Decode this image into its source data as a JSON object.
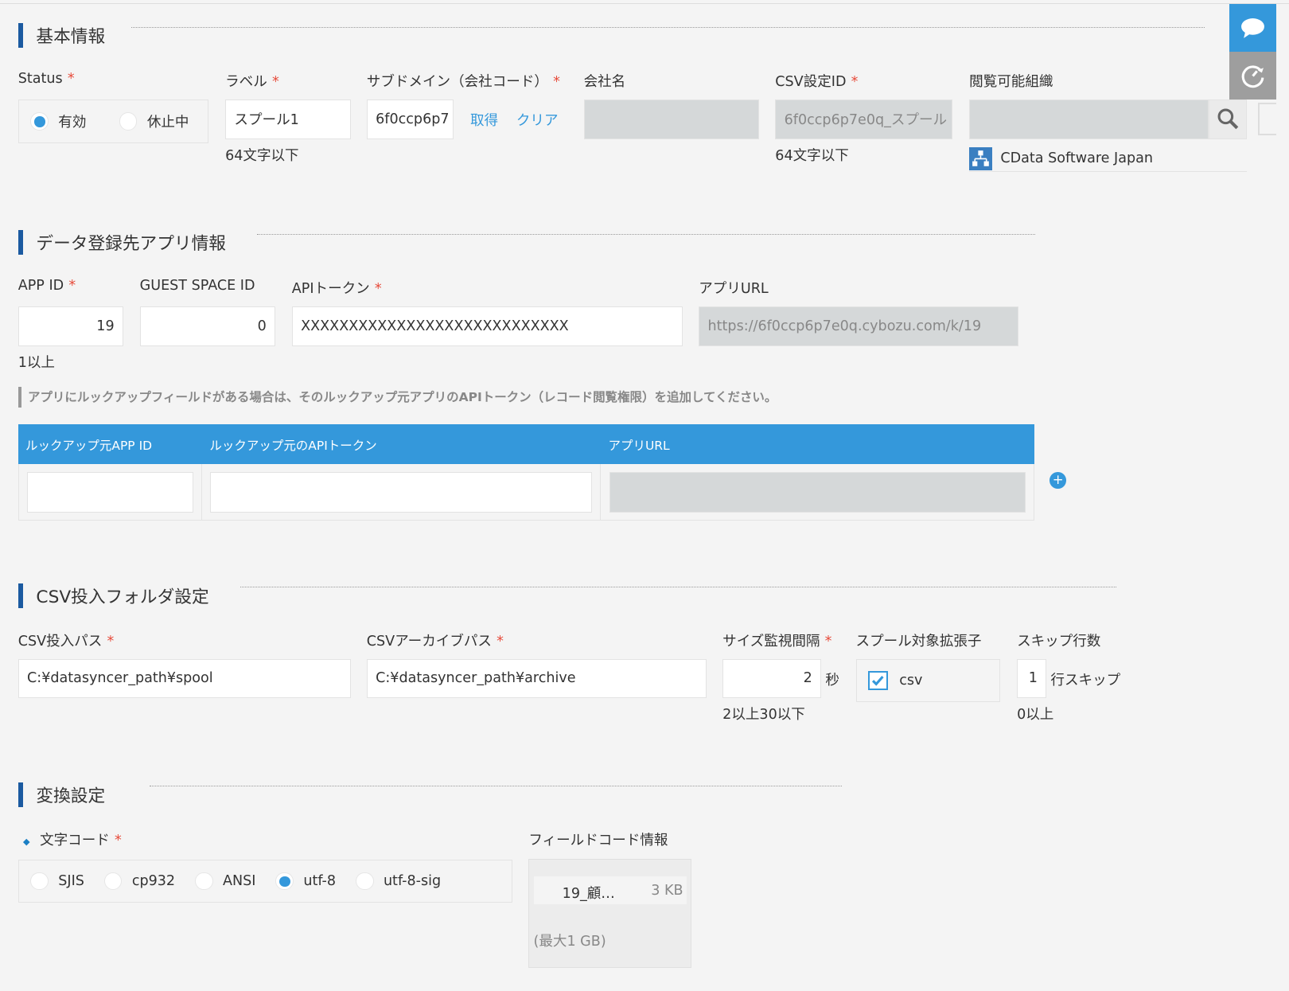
{
  "basic": {
    "title": "基本情報",
    "status_label": "Status",
    "status_options": [
      "有効",
      "休止中"
    ],
    "label_label": "ラベル",
    "label_value": "スプール1",
    "label_hint": "64文字以下",
    "subdomain_label": "サブドメイン（会社コード）",
    "subdomain_value": "6f0ccp6p7",
    "get_link": "取得",
    "clear_link": "クリア",
    "company_label": "会社名",
    "csvid_label": "CSV設定ID",
    "csvid_value": "6f0ccp6p7e0q_スプール",
    "csvid_hint": "64文字以下",
    "org_label": "閲覧可能組織",
    "org_entry": "CData Software Japan"
  },
  "app": {
    "title": "データ登録先アプリ情報",
    "appid_label": "APP ID",
    "appid_value": "19",
    "appid_hint": "1以上",
    "guest_label": "GUEST SPACE ID",
    "guest_value": "0",
    "token_label": "APIトークン",
    "token_value": "XXXXXXXXXXXXXXXXXXXXXXXXXXXX",
    "url_label": "アプリURL",
    "url_value": "https://6f0ccp6p7e0q.cybozu.com/k/19",
    "notice": "アプリにルックアップフィールドがある場合は、そのルックアップ元アプリのAPIトークン（レコード閲覧権限）を追加してください。",
    "lookup_headers": [
      "ルックアップ元APP ID",
      "ルックアップ元のAPIトークン",
      "アプリURL"
    ]
  },
  "folder": {
    "title": "CSV投入フォルダ設定",
    "input_label": "CSV投入パス",
    "input_value": "C:¥datasyncer_path¥spool",
    "archive_label": "CSVアーカイブパス",
    "archive_value": "C:¥datasyncer_path¥archive",
    "interval_label": "サイズ監視間隔",
    "interval_value": "2",
    "interval_unit": "秒",
    "interval_hint": "2以上30以下",
    "ext_label": "スプール対象拡張子",
    "ext_value": "csv",
    "skip_label": "スキップ行数",
    "skip_value": "1",
    "skip_unit": "行スキップ",
    "skip_hint": "0以上"
  },
  "convert": {
    "title": "変換設定",
    "charset_label": "文字コード",
    "charset_options": [
      "SJIS",
      "cp932",
      "ANSI",
      "utf-8",
      "utf-8-sig"
    ],
    "charset_selected": "utf-8",
    "field_label": "フィールドコード情報",
    "file_name": "19_顧…",
    "file_size": "3 KB",
    "max_size": "(最大1 GB)"
  },
  "colors": {
    "accent": "#3498db",
    "section_bar": "#1b5aa0",
    "required": "#e74c3c"
  }
}
